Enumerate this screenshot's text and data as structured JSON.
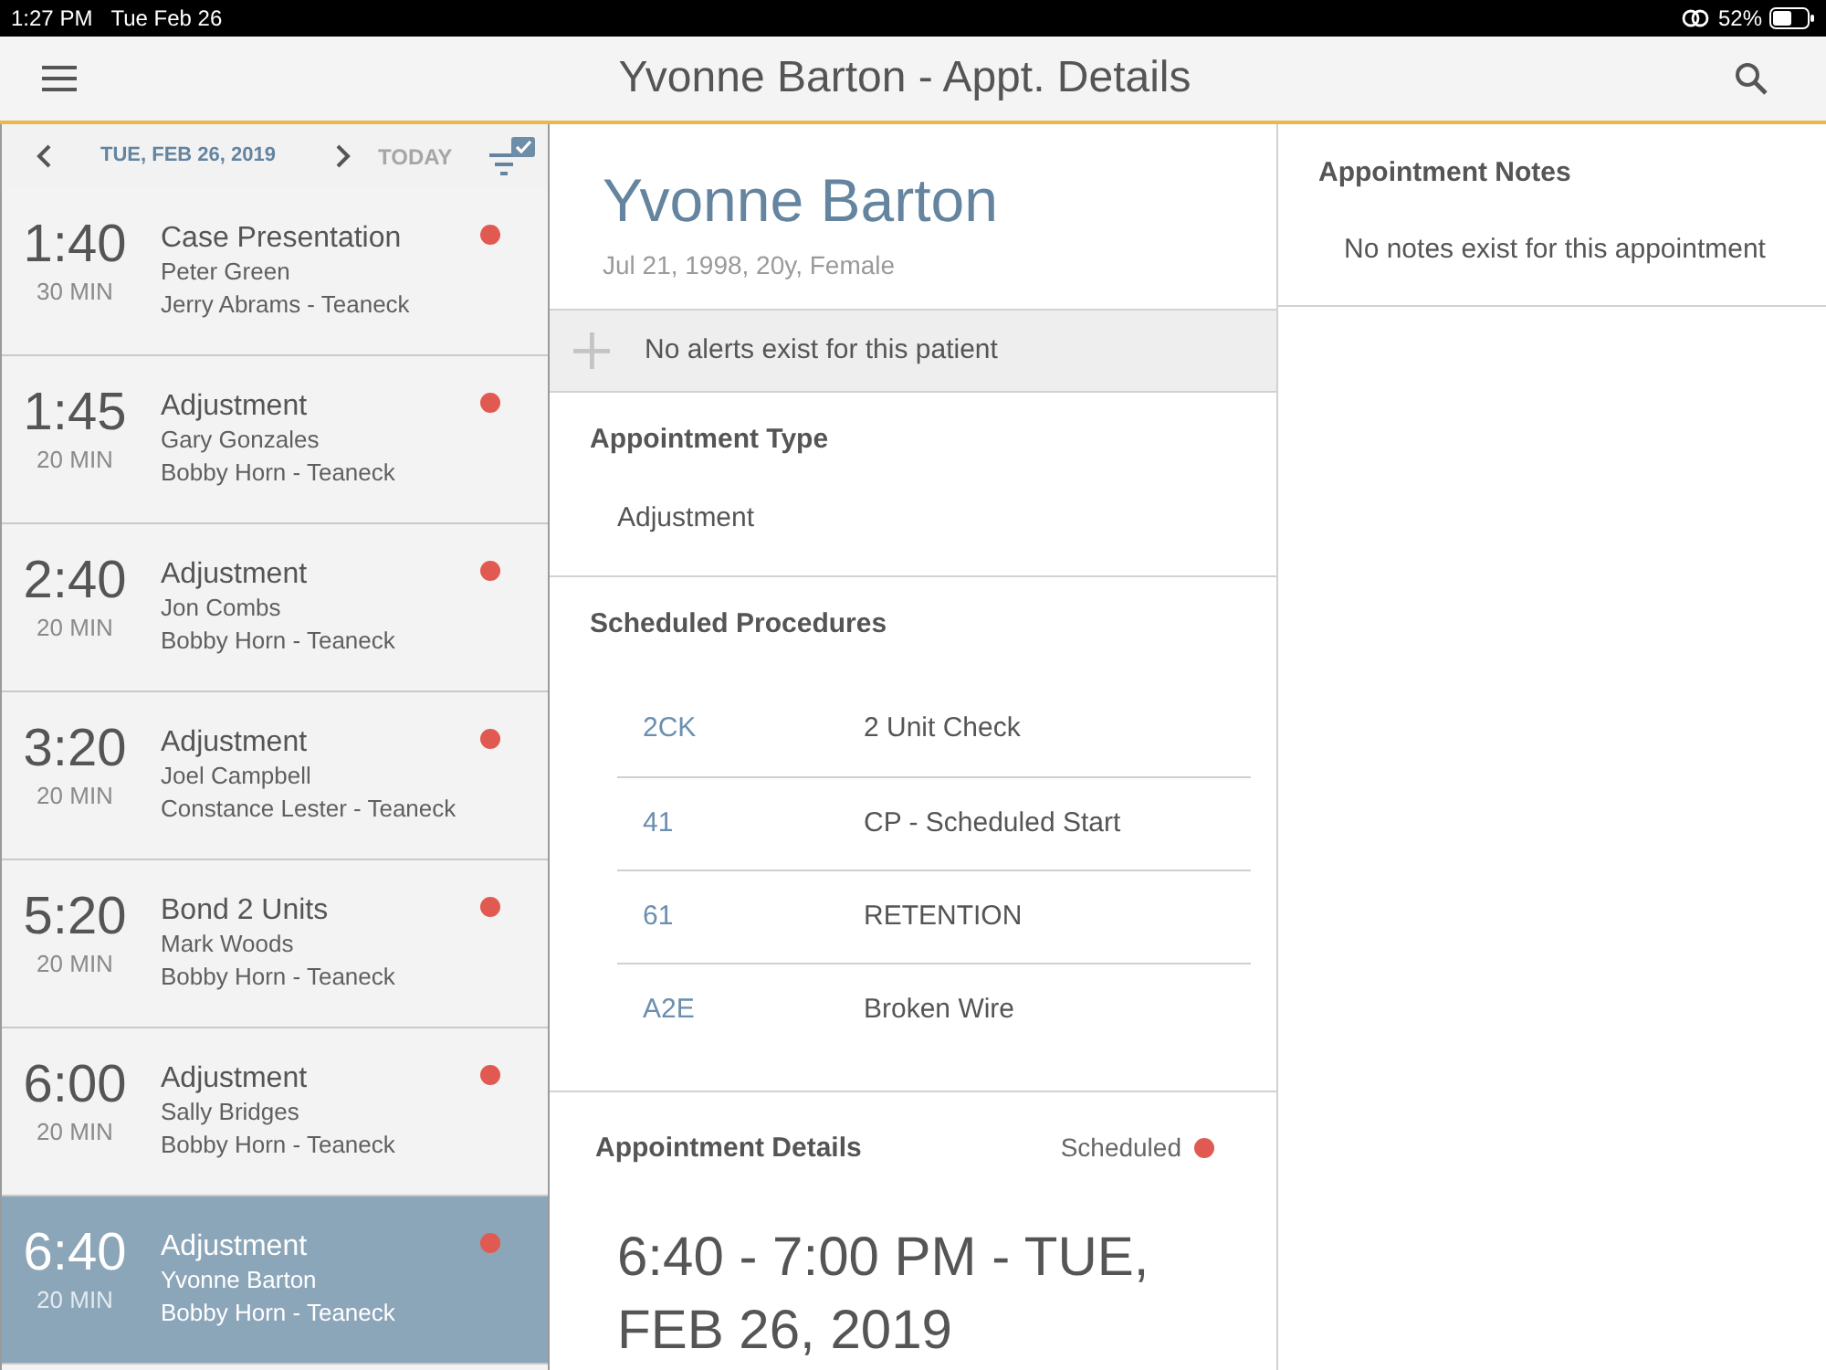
{
  "status_bar": {
    "time": "1:27 PM",
    "date": "Tue Feb 26",
    "battery": "52%"
  },
  "header": {
    "title": "Yvonne Barton - Appt. Details"
  },
  "date_nav": {
    "date": "TUE, FEB 26, 2019",
    "today": {
      "label": "TODAY",
      "disabled": true
    }
  },
  "appointments": [
    {
      "time": "1:40",
      "duration": "30 MIN",
      "type": "Case Presentation",
      "patient": "Peter Green",
      "provider": "Jerry Abrams - Teaneck",
      "color": "#e05a52",
      "selected": false
    },
    {
      "time": "1:45",
      "duration": "20 MIN",
      "type": "Adjustment",
      "patient": "Gary Gonzales",
      "provider": "Bobby Horn - Teaneck",
      "color": "#e05a52",
      "selected": false
    },
    {
      "time": "2:40",
      "duration": "20 MIN",
      "type": "Adjustment",
      "patient": "Jon Combs",
      "provider": "Bobby Horn - Teaneck",
      "color": "#e05a52",
      "selected": false
    },
    {
      "time": "3:20",
      "duration": "20 MIN",
      "type": "Adjustment",
      "patient": "Joel Campbell",
      "provider": "Constance Lester - Teaneck",
      "color": "#e05a52",
      "selected": false
    },
    {
      "time": "5:20",
      "duration": "20 MIN",
      "type": "Bond 2 Units",
      "patient": "Mark Woods",
      "provider": "Bobby Horn - Teaneck",
      "color": "#e05a52",
      "selected": false
    },
    {
      "time": "6:00",
      "duration": "20 MIN",
      "type": "Adjustment",
      "patient": "Sally Bridges",
      "provider": "Bobby Horn - Teaneck",
      "color": "#e05a52",
      "selected": false
    },
    {
      "time": "6:40",
      "duration": "20 MIN",
      "type": "Adjustment",
      "patient": "Yvonne Barton",
      "provider": "Bobby Horn - Teaneck",
      "color": "#e05a52",
      "selected": true
    }
  ],
  "patient": {
    "name": "Yvonne Barton",
    "details": "Jul 21, 1998, 20y, Female"
  },
  "alerts": {
    "message": "No alerts exist for this patient"
  },
  "appointment_type": {
    "heading": "Appointment Type",
    "value": "Adjustment"
  },
  "procedures": {
    "heading": "Scheduled Procedures",
    "rows": [
      {
        "code": "2CK",
        "description": "2 Unit Check"
      },
      {
        "code": "41",
        "description": "CP - Scheduled Start"
      },
      {
        "code": "61",
        "description": "RETENTION"
      },
      {
        "code": "A2E",
        "description": "Broken Wire"
      }
    ]
  },
  "details": {
    "heading": "Appointment Details",
    "status": {
      "label": "Scheduled",
      "color": "#e05a52"
    },
    "time_range": "6:40 - 7:00 PM - TUE, FEB 26, 2019"
  },
  "notes": {
    "heading": "Appointment Notes",
    "message": "No notes exist for this appointment"
  }
}
